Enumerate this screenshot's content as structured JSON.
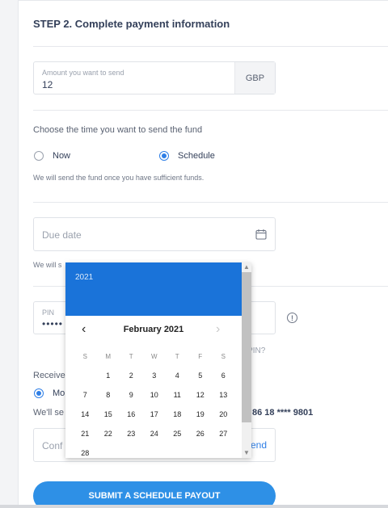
{
  "step_title": "STEP 2. Complete payment information",
  "amount": {
    "label": "Amount you want to send",
    "value": "12",
    "currency": "GBP"
  },
  "time": {
    "label": "Choose the time you want to send the fund",
    "options": [
      {
        "label": "Now",
        "checked": false
      },
      {
        "label": "Schedule",
        "checked": true
      }
    ],
    "hint": "We will send the fund once you have sufficient funds."
  },
  "due_date": {
    "placeholder": "Due date",
    "hint_partial": "We will s"
  },
  "pin": {
    "label": "PIN",
    "value": "•••••",
    "forgot_partial": "r PIN?"
  },
  "receive": {
    "label_partial": "Receive",
    "option_partial": "Mo",
    "send_text_partial": "We'll se",
    "phone_partial": "86 18 **** 9801"
  },
  "confirm": {
    "placeholder_partial": "Conf",
    "send_partial": "end"
  },
  "submit_label": "SUBMIT A SCHEDULE PAYOUT",
  "calendar": {
    "year": "2021",
    "month": "February 2021",
    "weekdays": [
      "S",
      "M",
      "T",
      "W",
      "T",
      "F",
      "S"
    ],
    "weeks": [
      [
        "",
        "1",
        "2",
        "3",
        "4",
        "5",
        "6"
      ],
      [
        "7",
        "8",
        "9",
        "10",
        "11",
        "12",
        "13"
      ],
      [
        "14",
        "15",
        "16",
        "17",
        "18",
        "19",
        "20"
      ],
      [
        "21",
        "22",
        "23",
        "24",
        "25",
        "26",
        "27"
      ],
      [
        "28",
        "",
        "",
        "",
        "",
        "",
        ""
      ]
    ]
  }
}
